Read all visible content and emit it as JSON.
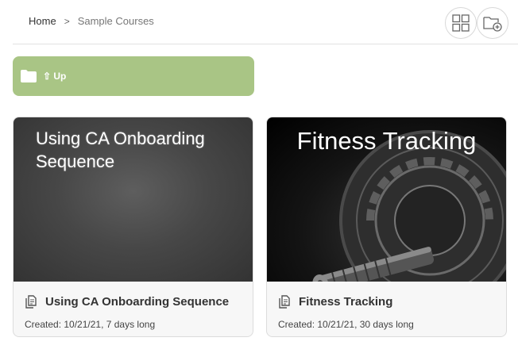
{
  "breadcrumb": {
    "home": "Home",
    "separator": ">",
    "current": "Sample Courses"
  },
  "toolbar": {
    "grid_view_icon": "grid-icon",
    "new_folder_icon": "folder-plus-icon"
  },
  "up_tile": {
    "label": "⇧ Up",
    "icon": "folder-icon",
    "color": "#a9c585"
  },
  "courses": [
    {
      "image_title": "Using CA Onboarding Sequence",
      "title": "Using CA Onboarding Sequence",
      "meta": "Created: 10/21/21, 7 days long",
      "icon": "documents-icon"
    },
    {
      "image_title": "Fitness Tracking",
      "title": "Fitness Tracking",
      "meta": "Created: 10/21/21, 30 days long",
      "icon": "documents-icon"
    }
  ]
}
